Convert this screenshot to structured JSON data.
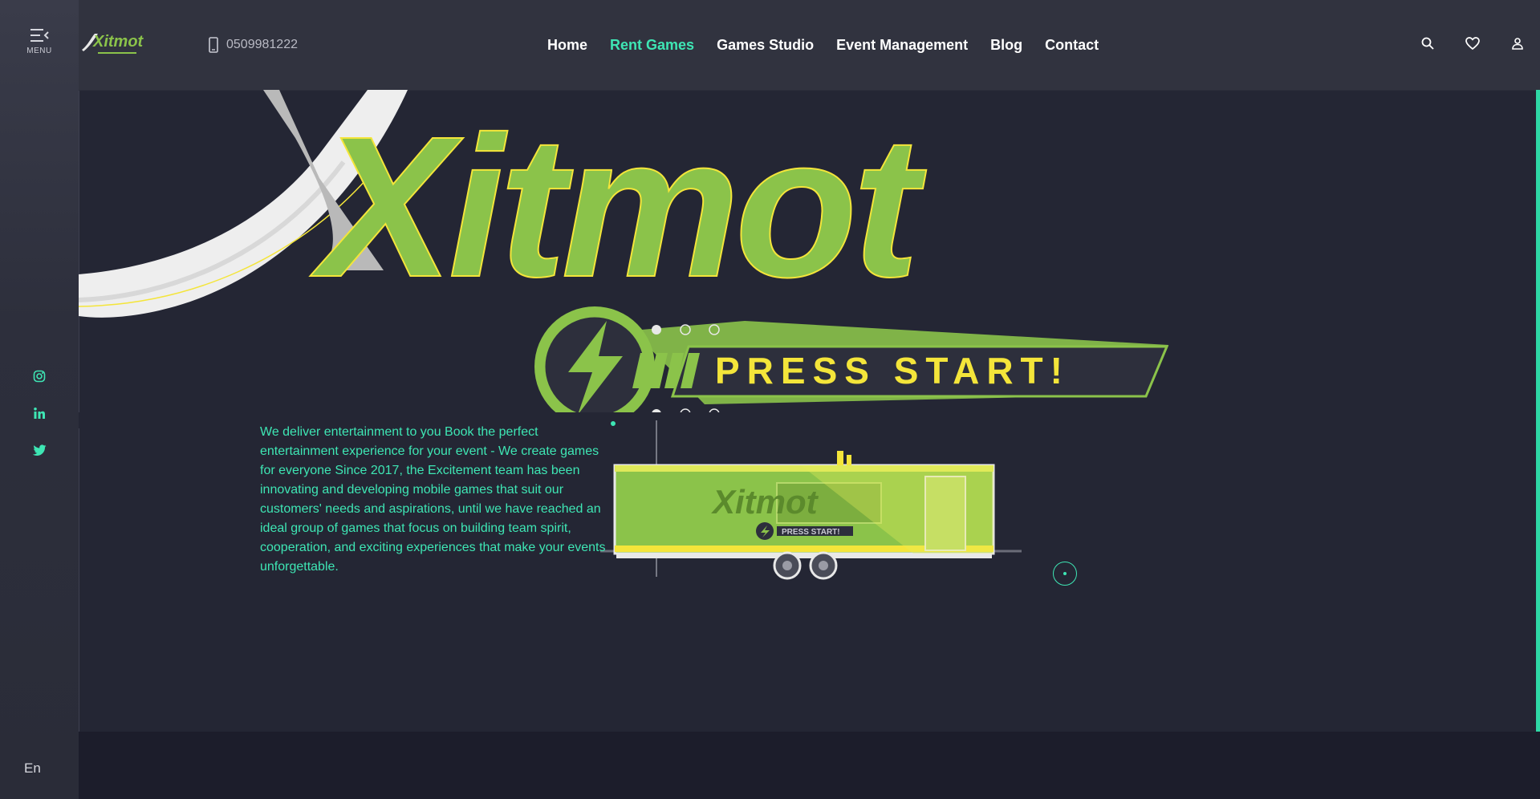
{
  "sidebar": {
    "menu_label": "MENU",
    "menu_icon": "hamburger-menu-icon",
    "socials": [
      {
        "name": "instagram-icon"
      },
      {
        "name": "linkedin-icon"
      },
      {
        "name": "twitter-icon"
      }
    ],
    "language": "En"
  },
  "header": {
    "logo_text": "Xitmot",
    "phone_icon": "mobile-phone-icon",
    "phone": "0509981222",
    "nav": [
      {
        "label": "Home",
        "active": false
      },
      {
        "label": "Rent Games",
        "active": true
      },
      {
        "label": "Games Studio",
        "active": false
      },
      {
        "label": "Event Management",
        "active": false
      },
      {
        "label": "Blog",
        "active": false
      },
      {
        "label": "Contact",
        "active": false
      }
    ],
    "icons": [
      "search-icon",
      "heart-icon",
      "user-icon"
    ]
  },
  "hero": {
    "brand": "Xitmot",
    "tagline": "PRESS START!",
    "trailer_brand": "Xitmot",
    "trailer_tagline": "PRESS START!",
    "description": "We deliver entertainment to you Book the perfect entertainment experience for your event - We create games for everyone Since 2017, the Excitement team has been innovating and developing mobile games that suit our customers' needs and aspirations, until we have reached an ideal group of games that focus on building team spirit, cooperation, and exciting experiences that make your events unforgettable."
  },
  "colors": {
    "accent": "#3ee6b4",
    "brand_green": "#8bc34a",
    "brand_yellow": "#f4e53a",
    "background": "#242634",
    "sidebar": "#2d2f3c"
  }
}
